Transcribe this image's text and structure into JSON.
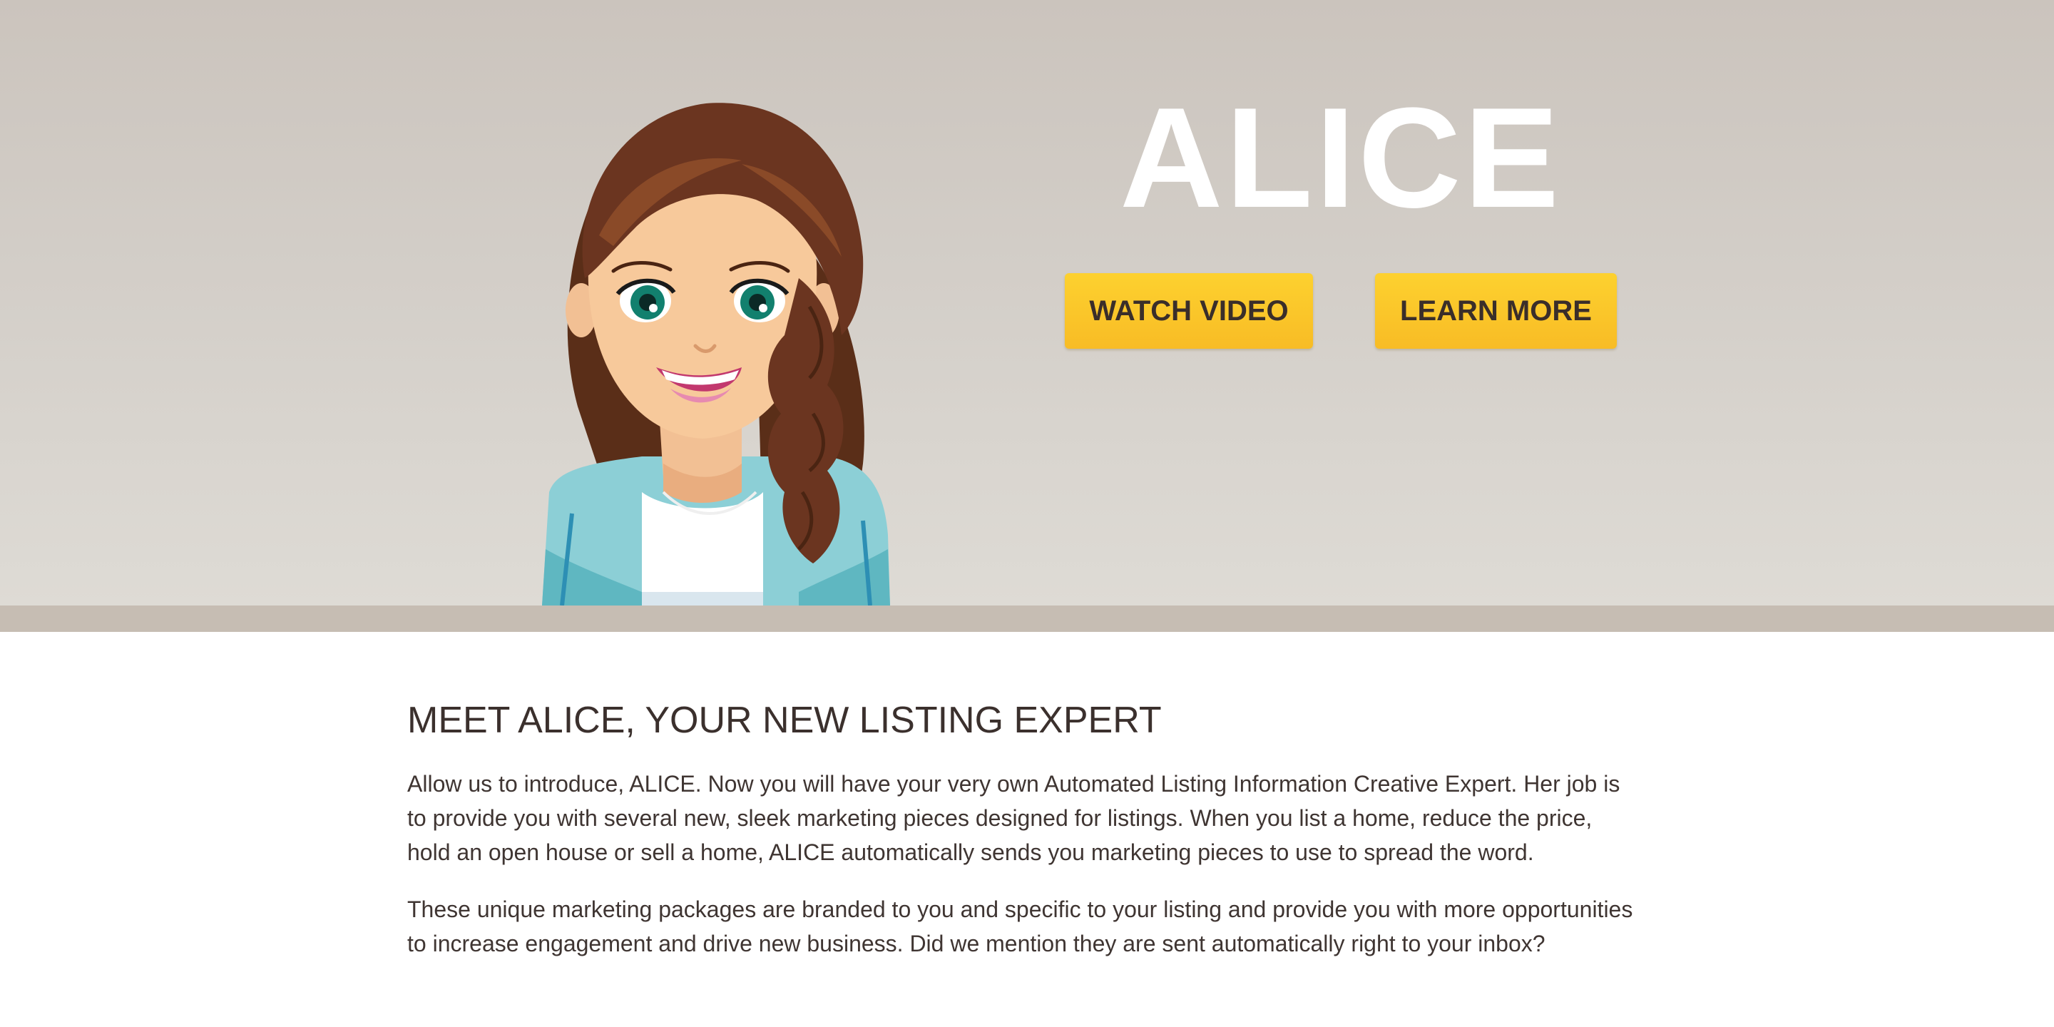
{
  "hero": {
    "title": "ALICE",
    "watch_video_label": "WATCH VIDEO",
    "learn_more_label": "LEARN MORE",
    "avatar_icon": "cartoon-woman-avatar",
    "colors": {
      "button_yellow": "#fdc92c",
      "button_text": "#3a2e2a",
      "background": "#d3cec8"
    }
  },
  "content": {
    "heading": "MEET ALICE, YOUR NEW LISTING EXPERT",
    "paragraph_1": "Allow us to introduce, ALICE. Now you will have your very own Automated Listing Information Creative Expert. Her job is to provide you with several new, sleek marketing pieces designed for listings. When you list a home, reduce the price, hold an open house or sell a home, ALICE automatically sends you marketing pieces to use to spread the word.",
    "paragraph_2": "These unique marketing packages are branded to you and specific to your listing and provide you with more opportunities to increase engagement and drive new business. Did we mention they are sent automatically right to your inbox?"
  }
}
